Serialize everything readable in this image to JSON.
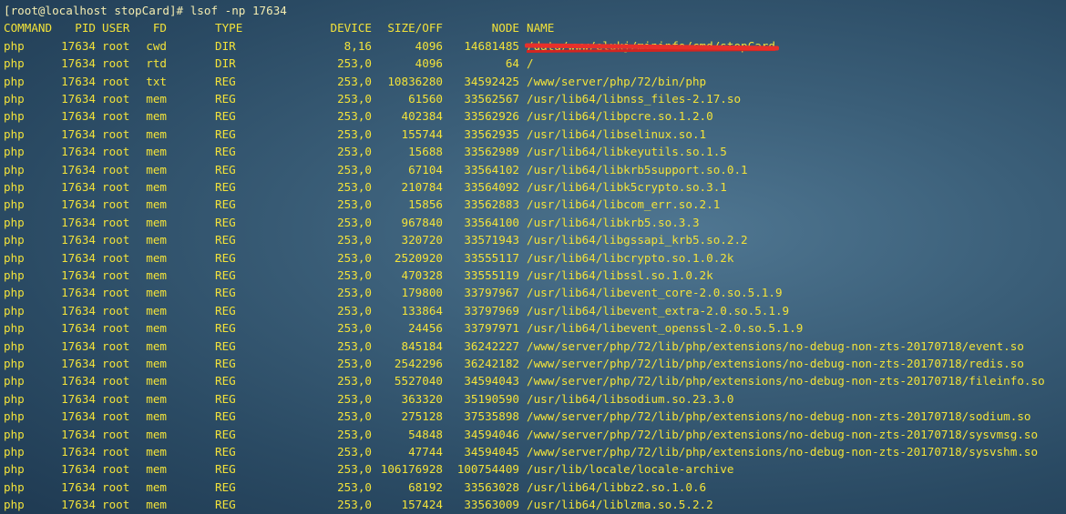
{
  "prompt": "[root@localhost stopCard]# lsof -np 17634",
  "header": {
    "command": "COMMAND",
    "pid": "PID",
    "user": "USER",
    "fd": "FD",
    "type": "TYPE",
    "device": "DEVICE",
    "size": "SIZE/OFF",
    "node": "NODE",
    "name": "NAME"
  },
  "rows": [
    {
      "command": "php",
      "pid": "17634",
      "user": "root",
      "fd": "cwd",
      "type": "DIR",
      "device": "8,16",
      "size": "4096",
      "node": "14681485",
      "name": "/data/www/elukj/mininfo/cmd/stopCard",
      "redacted": true
    },
    {
      "command": "php",
      "pid": "17634",
      "user": "root",
      "fd": "rtd",
      "type": "DIR",
      "device": "253,0",
      "size": "4096",
      "node": "64",
      "name": "/"
    },
    {
      "command": "php",
      "pid": "17634",
      "user": "root",
      "fd": "txt",
      "type": "REG",
      "device": "253,0",
      "size": "10836280",
      "node": "34592425",
      "name": "/www/server/php/72/bin/php"
    },
    {
      "command": "php",
      "pid": "17634",
      "user": "root",
      "fd": "mem",
      "type": "REG",
      "device": "253,0",
      "size": "61560",
      "node": "33562567",
      "name": "/usr/lib64/libnss_files-2.17.so"
    },
    {
      "command": "php",
      "pid": "17634",
      "user": "root",
      "fd": "mem",
      "type": "REG",
      "device": "253,0",
      "size": "402384",
      "node": "33562926",
      "name": "/usr/lib64/libpcre.so.1.2.0"
    },
    {
      "command": "php",
      "pid": "17634",
      "user": "root",
      "fd": "mem",
      "type": "REG",
      "device": "253,0",
      "size": "155744",
      "node": "33562935",
      "name": "/usr/lib64/libselinux.so.1"
    },
    {
      "command": "php",
      "pid": "17634",
      "user": "root",
      "fd": "mem",
      "type": "REG",
      "device": "253,0",
      "size": "15688",
      "node": "33562989",
      "name": "/usr/lib64/libkeyutils.so.1.5"
    },
    {
      "command": "php",
      "pid": "17634",
      "user": "root",
      "fd": "mem",
      "type": "REG",
      "device": "253,0",
      "size": "67104",
      "node": "33564102",
      "name": "/usr/lib64/libkrb5support.so.0.1"
    },
    {
      "command": "php",
      "pid": "17634",
      "user": "root",
      "fd": "mem",
      "type": "REG",
      "device": "253,0",
      "size": "210784",
      "node": "33564092",
      "name": "/usr/lib64/libk5crypto.so.3.1"
    },
    {
      "command": "php",
      "pid": "17634",
      "user": "root",
      "fd": "mem",
      "type": "REG",
      "device": "253,0",
      "size": "15856",
      "node": "33562883",
      "name": "/usr/lib64/libcom_err.so.2.1"
    },
    {
      "command": "php",
      "pid": "17634",
      "user": "root",
      "fd": "mem",
      "type": "REG",
      "device": "253,0",
      "size": "967840",
      "node": "33564100",
      "name": "/usr/lib64/libkrb5.so.3.3"
    },
    {
      "command": "php",
      "pid": "17634",
      "user": "root",
      "fd": "mem",
      "type": "REG",
      "device": "253,0",
      "size": "320720",
      "node": "33571943",
      "name": "/usr/lib64/libgssapi_krb5.so.2.2"
    },
    {
      "command": "php",
      "pid": "17634",
      "user": "root",
      "fd": "mem",
      "type": "REG",
      "device": "253,0",
      "size": "2520920",
      "node": "33555117",
      "name": "/usr/lib64/libcrypto.so.1.0.2k"
    },
    {
      "command": "php",
      "pid": "17634",
      "user": "root",
      "fd": "mem",
      "type": "REG",
      "device": "253,0",
      "size": "470328",
      "node": "33555119",
      "name": "/usr/lib64/libssl.so.1.0.2k"
    },
    {
      "command": "php",
      "pid": "17634",
      "user": "root",
      "fd": "mem",
      "type": "REG",
      "device": "253,0",
      "size": "179800",
      "node": "33797967",
      "name": "/usr/lib64/libevent_core-2.0.so.5.1.9"
    },
    {
      "command": "php",
      "pid": "17634",
      "user": "root",
      "fd": "mem",
      "type": "REG",
      "device": "253,0",
      "size": "133864",
      "node": "33797969",
      "name": "/usr/lib64/libevent_extra-2.0.so.5.1.9"
    },
    {
      "command": "php",
      "pid": "17634",
      "user": "root",
      "fd": "mem",
      "type": "REG",
      "device": "253,0",
      "size": "24456",
      "node": "33797971",
      "name": "/usr/lib64/libevent_openssl-2.0.so.5.1.9"
    },
    {
      "command": "php",
      "pid": "17634",
      "user": "root",
      "fd": "mem",
      "type": "REG",
      "device": "253,0",
      "size": "845184",
      "node": "36242227",
      "name": "/www/server/php/72/lib/php/extensions/no-debug-non-zts-20170718/event.so"
    },
    {
      "command": "php",
      "pid": "17634",
      "user": "root",
      "fd": "mem",
      "type": "REG",
      "device": "253,0",
      "size": "2542296",
      "node": "36242182",
      "name": "/www/server/php/72/lib/php/extensions/no-debug-non-zts-20170718/redis.so"
    },
    {
      "command": "php",
      "pid": "17634",
      "user": "root",
      "fd": "mem",
      "type": "REG",
      "device": "253,0",
      "size": "5527040",
      "node": "34594043",
      "name": "/www/server/php/72/lib/php/extensions/no-debug-non-zts-20170718/fileinfo.so"
    },
    {
      "command": "php",
      "pid": "17634",
      "user": "root",
      "fd": "mem",
      "type": "REG",
      "device": "253,0",
      "size": "363320",
      "node": "35190590",
      "name": "/usr/lib64/libsodium.so.23.3.0"
    },
    {
      "command": "php",
      "pid": "17634",
      "user": "root",
      "fd": "mem",
      "type": "REG",
      "device": "253,0",
      "size": "275128",
      "node": "37535898",
      "name": "/www/server/php/72/lib/php/extensions/no-debug-non-zts-20170718/sodium.so"
    },
    {
      "command": "php",
      "pid": "17634",
      "user": "root",
      "fd": "mem",
      "type": "REG",
      "device": "253,0",
      "size": "54848",
      "node": "34594046",
      "name": "/www/server/php/72/lib/php/extensions/no-debug-non-zts-20170718/sysvmsg.so"
    },
    {
      "command": "php",
      "pid": "17634",
      "user": "root",
      "fd": "mem",
      "type": "REG",
      "device": "253,0",
      "size": "47744",
      "node": "34594045",
      "name": "/www/server/php/72/lib/php/extensions/no-debug-non-zts-20170718/sysvshm.so"
    },
    {
      "command": "php",
      "pid": "17634",
      "user": "root",
      "fd": "mem",
      "type": "REG",
      "device": "253,0",
      "size": "106176928",
      "node": "100754409",
      "name": "/usr/lib/locale/locale-archive"
    },
    {
      "command": "php",
      "pid": "17634",
      "user": "root",
      "fd": "mem",
      "type": "REG",
      "device": "253,0",
      "size": "68192",
      "node": "33563028",
      "name": "/usr/lib64/libbz2.so.1.0.6"
    },
    {
      "command": "php",
      "pid": "17634",
      "user": "root",
      "fd": "mem",
      "type": "REG",
      "device": "253,0",
      "size": "157424",
      "node": "33563009",
      "name": "/usr/lib64/liblzma.so.5.2.2"
    }
  ],
  "colors": {
    "text": "#f2e23a",
    "prompt": "#f4ecb0",
    "redaction": "#e8302a",
    "background": "#3b5f79"
  }
}
